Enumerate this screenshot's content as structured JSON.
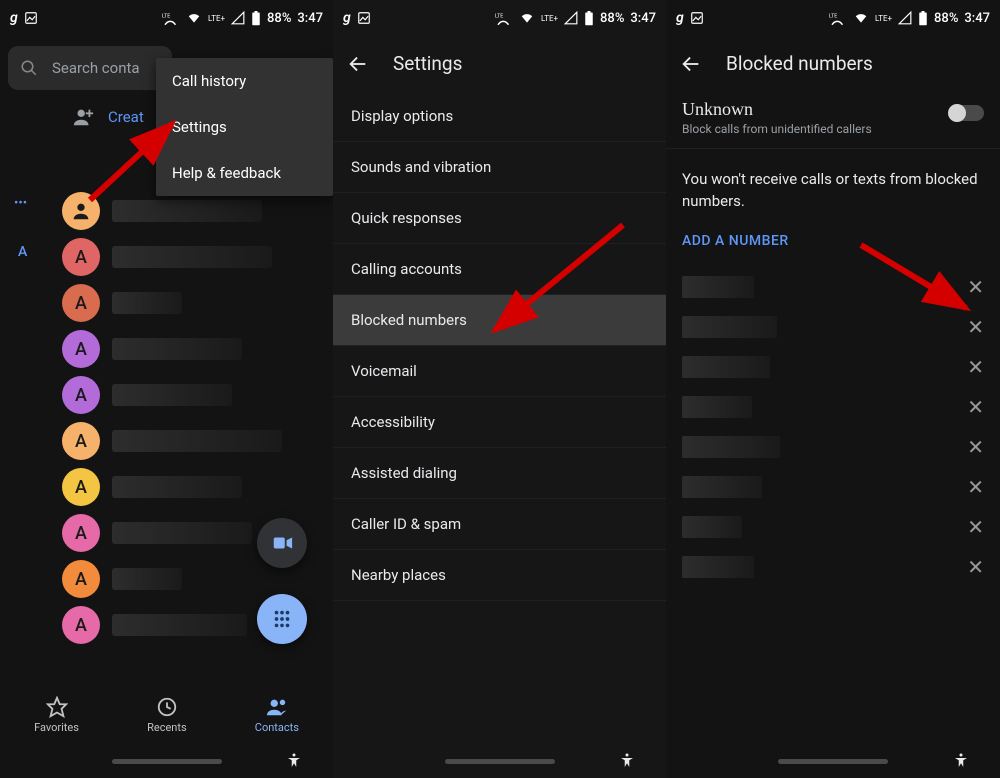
{
  "status_bar": {
    "battery": "88%",
    "time": "3:47",
    "lte": "LTE",
    "lte_plus": "LTE+"
  },
  "panel1": {
    "search_placeholder": "Search conta",
    "menu": {
      "call_history": "Call history",
      "settings": "Settings",
      "help": "Help & feedback"
    },
    "create_label": "Creat",
    "section_letter": "A",
    "bottom": {
      "favorites": "Favorites",
      "recents": "Recents",
      "contacts": "Contacts"
    },
    "contacts": [
      {
        "letter": "",
        "color": "#f6b26b",
        "width": 150
      },
      {
        "letter": "A",
        "color": "#e06666",
        "width": 160
      },
      {
        "letter": "A",
        "color": "#d96b4f",
        "width": 70
      },
      {
        "letter": "A",
        "color": "#b36bd9",
        "width": 130
      },
      {
        "letter": "A",
        "color": "#b36bd9",
        "width": 120
      },
      {
        "letter": "A",
        "color": "#f6b26b",
        "width": 170
      },
      {
        "letter": "A",
        "color": "#f4c542",
        "width": 130
      },
      {
        "letter": "A",
        "color": "#e66aa8",
        "width": 140
      },
      {
        "letter": "A",
        "color": "#f28b3b",
        "width": 70
      },
      {
        "letter": "A",
        "color": "#e66aa8",
        "width": 135
      }
    ]
  },
  "panel2": {
    "title": "Settings",
    "items": [
      {
        "label": "Display options"
      },
      {
        "label": "Sounds and vibration"
      },
      {
        "label": "Quick responses"
      },
      {
        "label": "Calling accounts"
      },
      {
        "label": "Blocked numbers",
        "highlight": true
      },
      {
        "label": "Voicemail"
      },
      {
        "label": "Accessibility"
      },
      {
        "label": "Assisted dialing"
      },
      {
        "label": "Caller ID & spam"
      },
      {
        "label": "Nearby places"
      }
    ]
  },
  "panel3": {
    "title": "Blocked numbers",
    "unknown_title": "Unknown",
    "unknown_sub": "Block calls from unidentified callers",
    "description": "You won't receive calls or texts from blocked numbers.",
    "add_number": "ADD A NUMBER",
    "rows": [
      {
        "width": 72
      },
      {
        "width": 95
      },
      {
        "width": 88
      },
      {
        "width": 70
      },
      {
        "width": 98
      },
      {
        "width": 80
      },
      {
        "width": 60
      },
      {
        "width": 72
      }
    ]
  }
}
